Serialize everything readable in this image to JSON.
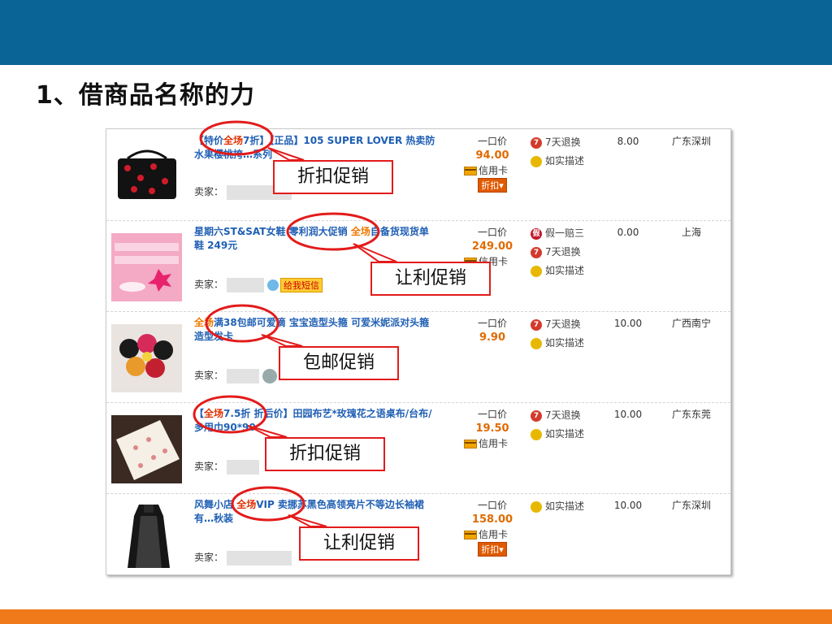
{
  "slide": {
    "title": "1、借商品名称的力"
  },
  "seller_label": "卖家：",
  "price_label": "一口价",
  "credit_label": "信用卡",
  "discount_label": "折扣▾",
  "send_msg_label": "给我短信",
  "products": [
    {
      "title_pre": "【特价",
      "title_hl": "全场",
      "title_post": "7折】【正品】105 SUPER LOVER 热卖防水果樱桃挎…系列",
      "price": "94.00",
      "credit": true,
      "discount": true,
      "services": [
        {
          "icon": "return-icon",
          "label": "7天退换"
        },
        {
          "icon": "describe-icon",
          "label": "如实描述"
        }
      ],
      "fee": "8.00",
      "location": "广东深圳",
      "callout": "折扣促销"
    },
    {
      "title_pre": "星期六ST&SAT女鞋 零利润大促销 ",
      "title_hl": "全场",
      "title_post": "自备货现货单鞋 249元",
      "price": "249.00",
      "credit": true,
      "discount": false,
      "services": [
        {
          "icon": "fake-icon",
          "label": "假一赔三"
        },
        {
          "icon": "return-icon",
          "label": "7天退换"
        },
        {
          "icon": "describe-icon",
          "label": "如实描述"
        }
      ],
      "fee": "0.00",
      "location": "上海",
      "callout": "让利促销"
    },
    {
      "title_pre": "",
      "title_hl": "全场",
      "title_post": "满38包邮可爱滴 宝宝造型头箍 可爱米妮派对头箍 造型发卡",
      "price": "9.90",
      "credit": false,
      "discount": false,
      "services": [
        {
          "icon": "return-icon",
          "label": "7天退换"
        },
        {
          "icon": "describe-icon",
          "label": "如实描述"
        }
      ],
      "fee": "10.00",
      "location": "广西南宁",
      "callout": "包邮促销"
    },
    {
      "title_pre": "【",
      "title_hl": "全场",
      "title_post": "7.5折 折后价】田园布艺*玫瑰花之语桌布/台布/多用巾90*90",
      "price": "19.50",
      "credit": true,
      "discount": false,
      "services": [
        {
          "icon": "return-icon",
          "label": "7天退换"
        },
        {
          "icon": "describe-icon",
          "label": "如实描述"
        }
      ],
      "fee": "10.00",
      "location": "广东东莞",
      "callout": "折扣促销"
    },
    {
      "title_pre": "风舞小店 ",
      "title_hl": "全场",
      "title_post": "VIP 卖挪苏黑色高领亮片不等边长袖裙 有…秋装",
      "price": "158.00",
      "credit": true,
      "discount": true,
      "services": [
        {
          "icon": "describe-icon",
          "label": "如实描述"
        }
      ],
      "fee": "10.00",
      "location": "广东深圳",
      "callout": "让利促销"
    }
  ],
  "colors": {
    "top_bar": "#0b6496",
    "bottom_bar": "#f07a1a",
    "link": "#1f5fb4",
    "price": "#e06b00",
    "callout_border": "#e31b1b"
  }
}
